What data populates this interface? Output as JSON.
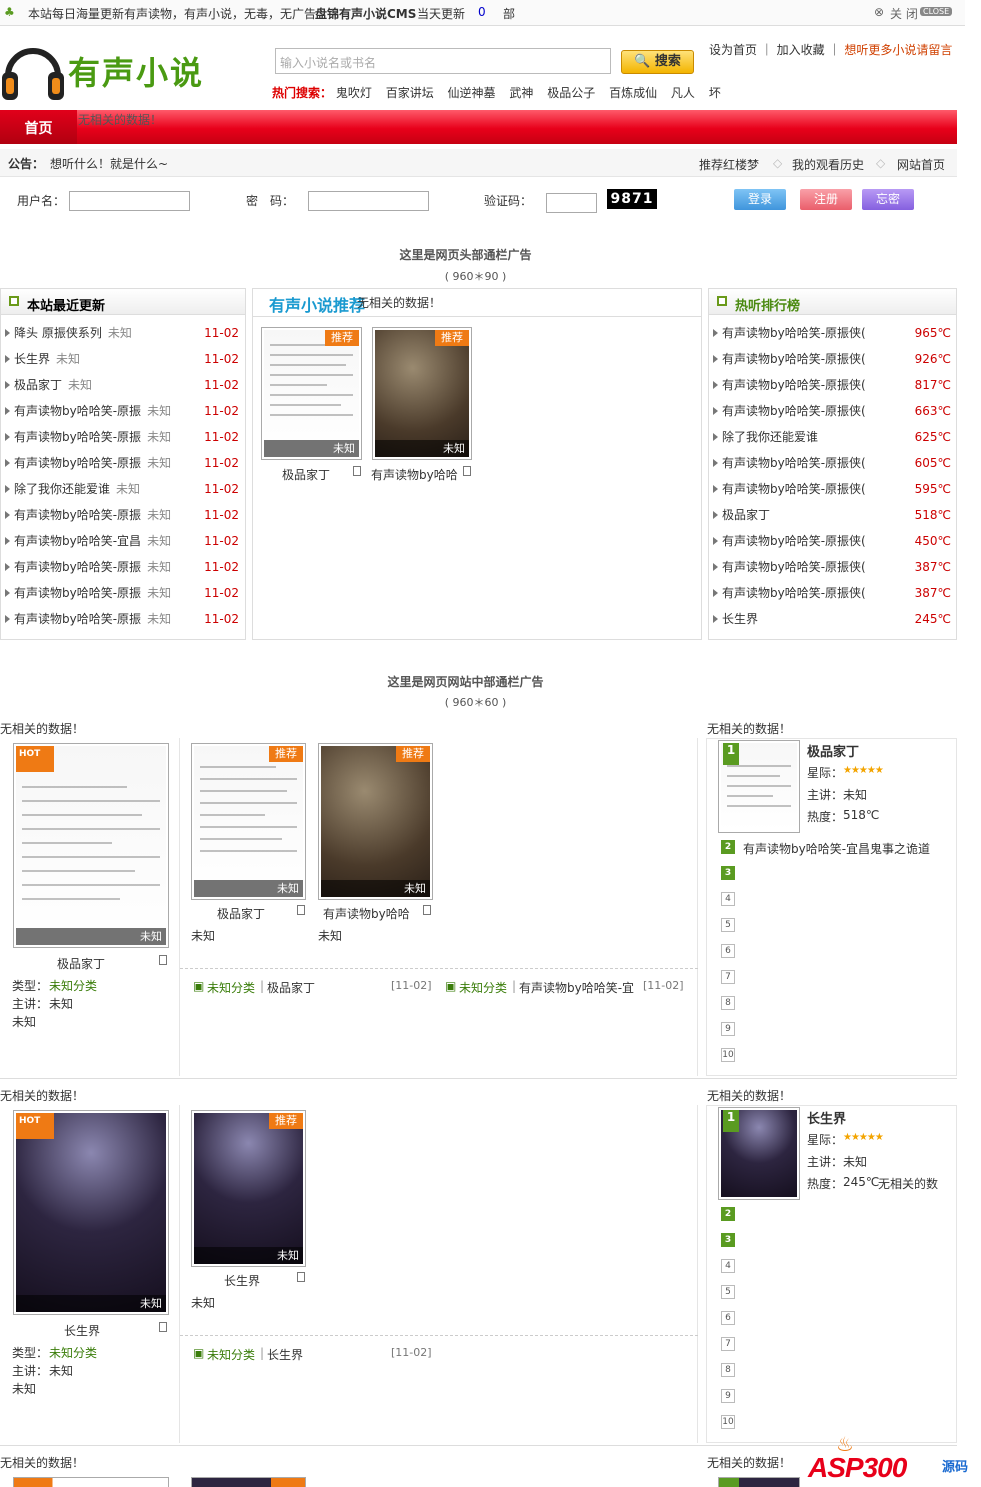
{
  "topbar": {
    "welcome": "本站每日海量更新有声读物，有声小说，无毒，无广告",
    "cms": "盘锦有声小说CMS",
    "today": "当天更新",
    "today_count": "0",
    "unit": "部",
    "close": "关 闭",
    "close_btn": "CLOSE"
  },
  "logo": {
    "text": "有声小说"
  },
  "search": {
    "placeholder": "输入小说名或书名",
    "button": "搜索"
  },
  "hot_search": {
    "label": "热门搜索：",
    "items": [
      "鬼吹灯",
      "百家讲坛",
      "仙逆神墓",
      "武神",
      "极品公子",
      "百炼成仙",
      "凡人",
      "坏"
    ]
  },
  "top_links": {
    "home": "设为首页",
    "fav": "加入收藏",
    "msg": "想听更多小说请留言"
  },
  "nav": {
    "home": "首页",
    "msg": "无相关的数据！"
  },
  "notice": {
    "label": "公告：",
    "text": "想听什么！就是什么~",
    "links": [
      "推荐红楼梦",
      "我的观看历史",
      "网站首页"
    ]
  },
  "login": {
    "user": "用户名：",
    "pass": "密　码：",
    "code": "验证码：",
    "captcha": "9871",
    "btn_login": "登录",
    "btn_reg": "注册",
    "btn_forgot": "忘密"
  },
  "ad1": {
    "title": "这里是网页头部通栏广告",
    "size": "( 960＊90 )"
  },
  "ad2": {
    "title": "这里是网页网站中部通栏广告",
    "size": "( 960＊60 )"
  },
  "latest": {
    "title": "本站最近更新",
    "items": [
      {
        "name": "降头 原振侠系列",
        "who": "未知",
        "date": "11-02"
      },
      {
        "name": "长生界",
        "who": "未知",
        "date": "11-02"
      },
      {
        "name": "极品家丁",
        "who": "未知",
        "date": "11-02"
      },
      {
        "name": "有声读物by哈哈笑-原振",
        "who": "未知",
        "date": "11-02"
      },
      {
        "name": "有声读物by哈哈笑-原振",
        "who": "未知",
        "date": "11-02"
      },
      {
        "name": "有声读物by哈哈笑-原振",
        "who": "未知",
        "date": "11-02"
      },
      {
        "name": "除了我你还能爱谁",
        "who": "未知",
        "date": "11-02"
      },
      {
        "name": "有声读物by哈哈笑-原振",
        "who": "未知",
        "date": "11-02"
      },
      {
        "name": "有声读物by哈哈笑-宜昌",
        "who": "未知",
        "date": "11-02"
      },
      {
        "name": "有声读物by哈哈笑-原振",
        "who": "未知",
        "date": "11-02"
      },
      {
        "name": "有声读物by哈哈笑-原振",
        "who": "未知",
        "date": "11-02"
      },
      {
        "name": "有声读物by哈哈笑-原振",
        "who": "未知",
        "date": "11-02"
      }
    ]
  },
  "recommend": {
    "title": "有声小说推荐",
    "msg": "无相关的数据！",
    "items": [
      {
        "name": "极品家丁",
        "tag": "推荐",
        "status": "未知"
      },
      {
        "name": "有声读物by哈哈",
        "tag": "推荐",
        "status": "未知"
      }
    ]
  },
  "ranking": {
    "title": "热听排行榜",
    "items": [
      {
        "name": "有声读物by哈哈笑-原振侠(",
        "heat": "965℃"
      },
      {
        "name": "有声读物by哈哈笑-原振侠(",
        "heat": "926℃"
      },
      {
        "name": "有声读物by哈哈笑-原振侠(",
        "heat": "817℃"
      },
      {
        "name": "有声读物by哈哈笑-原振侠(",
        "heat": "663℃"
      },
      {
        "name": "除了我你还能爱谁",
        "heat": "625℃"
      },
      {
        "name": "有声读物by哈哈笑-原振侠(",
        "heat": "605℃"
      },
      {
        "name": "有声读物by哈哈笑-原振侠(",
        "heat": "595℃"
      },
      {
        "name": "极品家丁",
        "heat": "518℃"
      },
      {
        "name": "有声读物by哈哈笑-原振侠(",
        "heat": "450℃"
      },
      {
        "name": "有声读物by哈哈笑-原振侠(",
        "heat": "387℃"
      },
      {
        "name": "有声读物by哈哈笑-原振侠(",
        "heat": "387℃"
      },
      {
        "name": "长生界",
        "heat": "245℃"
      }
    ]
  },
  "sec1": {
    "msg_left": "无相关的数据！",
    "msg_right": "无相关的数据！",
    "big": {
      "hot": "HOT",
      "name": "极品家丁",
      "status": "未知",
      "type_label": "类型：",
      "type": "未知分类",
      "host_label": "主讲：",
      "host": "未知",
      "extra": "未知"
    },
    "items": [
      {
        "name": "极品家丁",
        "tag": "推荐",
        "status": "未知",
        "sub": "未知"
      },
      {
        "name": "有声读物by哈哈",
        "tag": "推荐",
        "status": "未知",
        "sub": "未知"
      }
    ],
    "list": [
      {
        "cat": "未知分类",
        "name": "极品家丁",
        "date": "[11-02]"
      },
      {
        "cat": "未知分类",
        "name": "有声读物by哈哈笑-宜",
        "date": "[11-02]"
      }
    ],
    "top": {
      "name": "极品家丁",
      "star_label": "星际：",
      "host_label": "主讲：",
      "host": "未知",
      "heat_label": "热度：",
      "heat": "518℃",
      "extra": ""
    },
    "rank2": "有声读物by哈哈笑-宜昌鬼事之诡道",
    "nums": [
      "1",
      "2",
      "3",
      "4",
      "5",
      "6",
      "7",
      "8",
      "9",
      "10"
    ]
  },
  "sec2": {
    "msg_left": "无相关的数据！",
    "msg_right": "无相关的数据！",
    "big": {
      "hot": "HOT",
      "name": "长生界",
      "status": "未知",
      "type_label": "类型：",
      "type": "未知分类",
      "host_label": "主讲：",
      "host": "未知",
      "extra": "未知"
    },
    "items": [
      {
        "name": "长生界",
        "tag": "推荐",
        "status": "未知",
        "sub": "未知"
      }
    ],
    "list": [
      {
        "cat": "未知分类",
        "name": "长生界",
        "date": "[11-02]"
      }
    ],
    "top": {
      "name": "长生界",
      "star_label": "星际：",
      "host_label": "主讲：",
      "host": "未知",
      "heat_label": "热度：",
      "heat": "245℃",
      "extra": "无相关的数"
    },
    "nums": [
      "1",
      "2",
      "3",
      "4",
      "5",
      "6",
      "7",
      "8",
      "9",
      "10"
    ]
  },
  "sec3": {
    "msg_left": "无相关的数据！",
    "msg_right": "无相关的数据！"
  },
  "watermark": {
    "text": "ASP300",
    "sub": "源码"
  },
  "colors": {
    "red": "#e8001a",
    "green": "#5a9b21",
    "orange": "#ef7a14"
  }
}
